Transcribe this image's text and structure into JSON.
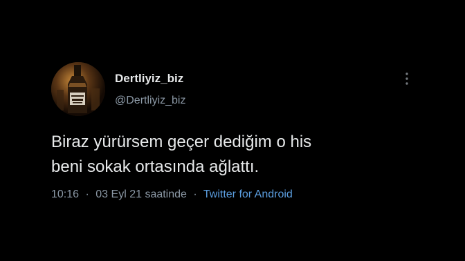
{
  "user": {
    "display_name": "Dertliyiz_biz",
    "handle": "@Dertliyiz_biz",
    "avatar_icon": "whiskey-bottle-avatar"
  },
  "tweet": {
    "lines": [
      "Biraz yürürsem geçer dediğim o his",
      "beni sokak ortasında ağlattı."
    ],
    "time": "10:16",
    "date_text": "03 Eyl 21 saatinde",
    "separator": "·",
    "source": "Twitter for Android"
  },
  "icons": {
    "menu": "more-vertical-icon"
  },
  "colors": {
    "background": "#000000",
    "text": "#e7e9ea",
    "secondary": "#8b98a5",
    "link": "#5b9ee0"
  }
}
